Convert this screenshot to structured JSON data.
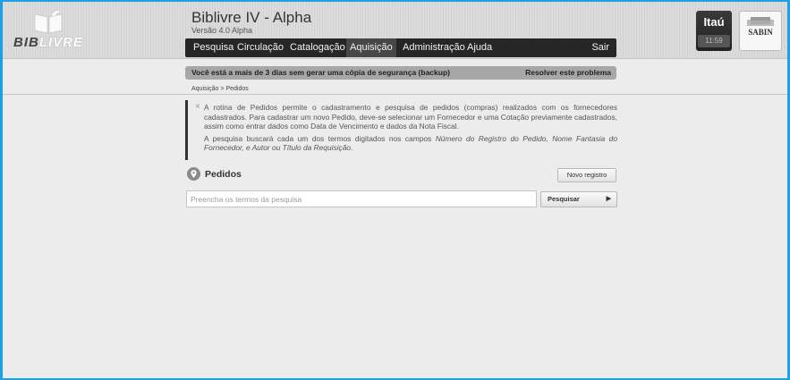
{
  "branding": {
    "logo_text_dark": "BIB",
    "logo_text_light": "LIVRE",
    "app_title": "Biblivre IV - Alpha",
    "version": "Versão 4.0 Alpha"
  },
  "menu": {
    "items": [
      {
        "label": "Pesquisa"
      },
      {
        "label": "Circulação"
      },
      {
        "label": "Catalogação"
      },
      {
        "label": "Aquisição",
        "active": true
      },
      {
        "label": "Administração"
      },
      {
        "label": "Ajuda"
      }
    ],
    "logout_label": "Sair"
  },
  "institution": {
    "name": "Itaú",
    "clock": "11:59",
    "sponsor": "SABIN"
  },
  "backup_notice": {
    "message": "Você está a mais de 3 dias sem gerar uma cópia de segurança (backup)",
    "action": "Resolver este problema"
  },
  "breadcrumb": {
    "parent": "Aquisição",
    "separator": ">",
    "current": "Pedidos"
  },
  "info": {
    "close_glyph": "×",
    "paragraph1": "A rotina de Pedidos permite o cadastramento e pesquisa de pedidos (compras) realizados com os fornecedores cadastrados. Para cadastrar um novo Pedido, deve-se selecionar um Fornecedor e uma Cotação previamente cadastrados, assim como entrar dados como Data de Vencimento e dados da Nota Fiscal.",
    "paragraph2_prefix": "A pesquisa buscará cada um dos termos digitados nos campos ",
    "paragraph2_fields": "Número do Registro do Pedido, Nome Fantasia do Fornecedor, e Autor ou Título da Requisição",
    "paragraph2_suffix": "."
  },
  "section": {
    "title": "Pedidos",
    "new_record_label": "Novo registro"
  },
  "search": {
    "placeholder": "Preencha os termos da pesquisa",
    "value": "",
    "button_label": "Pesquisar",
    "button_arrow": "▶"
  },
  "colors": {
    "frame_border": "#1ea0e6",
    "menubar": "#262626",
    "backup_bar": "#a7a7a7"
  }
}
